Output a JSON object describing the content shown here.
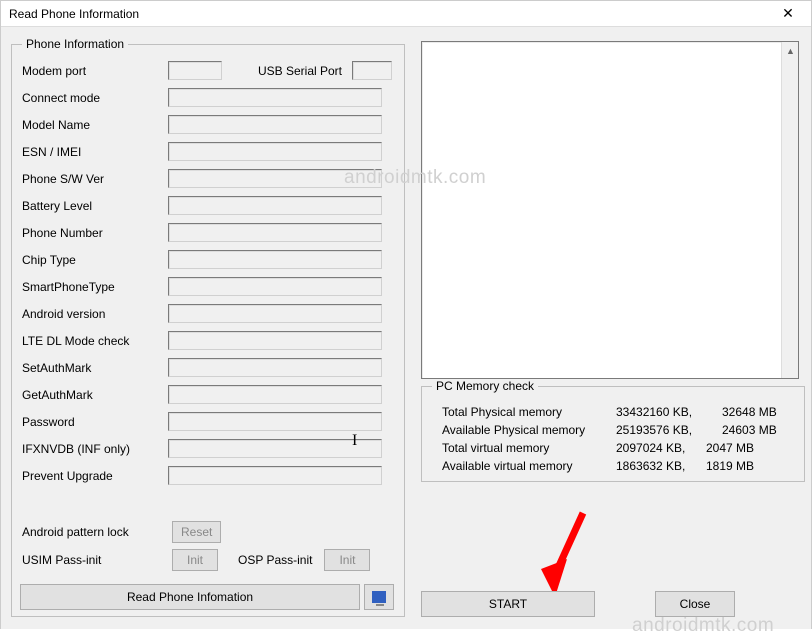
{
  "window": {
    "title": "Read Phone Information",
    "close_x": "✕"
  },
  "group": {
    "phone_info": "Phone Information",
    "pc_mem": "PC Memory check"
  },
  "labels": {
    "modem_port": "Modem port",
    "usb_serial": "USB Serial Port",
    "connect_mode": "Connect mode",
    "model_name": "Model Name",
    "esn_imei": "ESN / IMEI",
    "phone_sw": "Phone S/W Ver",
    "battery": "Battery Level",
    "phone_number": "Phone Number",
    "chip_type": "Chip Type",
    "smartphone": "SmartPhoneType",
    "android_version": "Android version",
    "lte_dl": "LTE DL Mode check",
    "setauth": "SetAuthMark",
    "getauth": "GetAuthMark",
    "password": "Password",
    "ifxnvdb": "IFXNVDB (INF only)",
    "prevent_upgrade": "Prevent Upgrade",
    "pattern_lock": "Android pattern lock",
    "usim_pass": "USIM Pass-init",
    "osp_pass": "OSP Pass-init"
  },
  "buttons": {
    "reset": "Reset",
    "init1": "Init",
    "init2": "Init",
    "read_phone": "Read Phone Infomation",
    "start": "START",
    "close": "Close"
  },
  "mem": {
    "total_phys_lbl": "Total Physical memory",
    "avail_phys_lbl": "Available Physical memory",
    "total_virt_lbl": "Total virtual memory",
    "avail_virt_lbl": "Available virtual memory",
    "total_phys_kb": "33432160 KB,",
    "total_phys_mb": "32648 MB",
    "avail_phys_kb": "25193576 KB,",
    "avail_phys_mb": "24603 MB",
    "total_virt_kb": "2097024 KB,",
    "total_virt_mb": "2047 MB",
    "avail_virt_kb": "1863632 KB,",
    "avail_virt_mb": "1819 MB"
  },
  "watermark": "androidmtk.com"
}
